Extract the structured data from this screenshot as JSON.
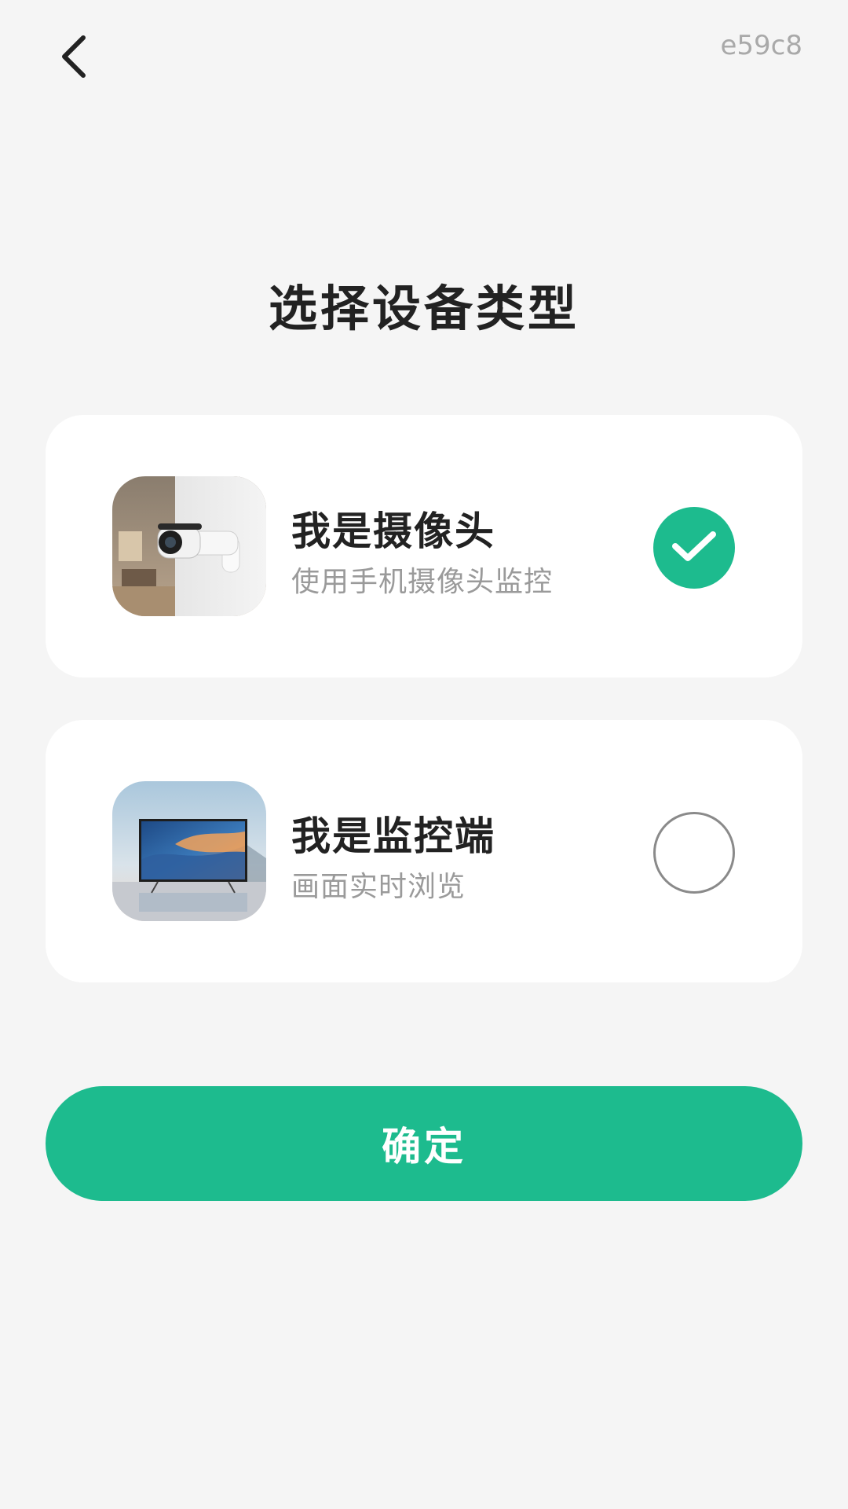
{
  "header": {
    "back_icon": "chevron-left-icon",
    "corner_id": "e59c8"
  },
  "title": "选择设备类型",
  "options": [
    {
      "title": "我是摄像头",
      "subtitle": "使用手机摄像头监控",
      "image": "security-camera-photo",
      "selected": true
    },
    {
      "title": "我是监控端",
      "subtitle": "画面实时浏览",
      "image": "tv-monitor-photo",
      "selected": false
    }
  ],
  "confirm_label": "确定",
  "colors": {
    "accent": "#1dbb8e",
    "background": "#f5f5f5",
    "card": "#ffffff"
  }
}
